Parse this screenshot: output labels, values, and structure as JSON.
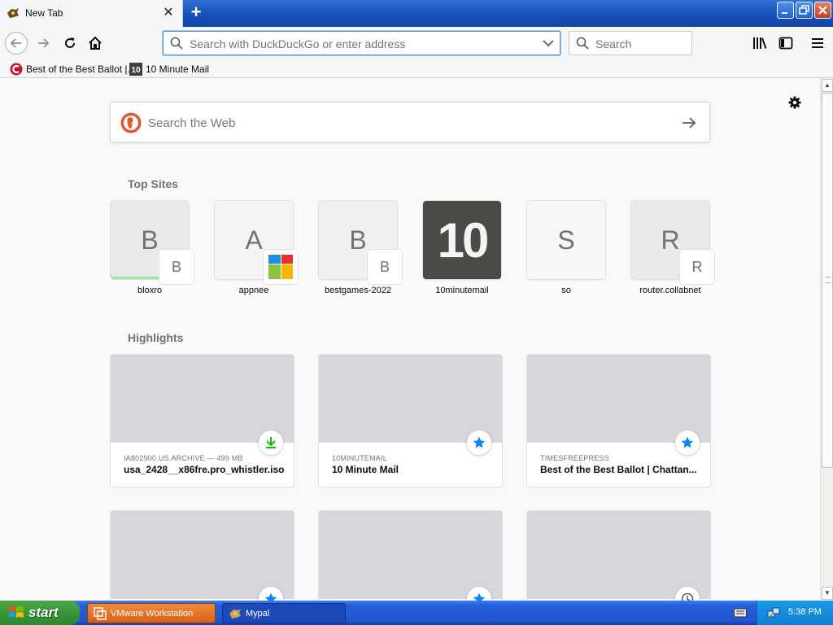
{
  "window": {
    "tab_title": "New Tab",
    "new_tab_symbol": "+",
    "close_symbol": "✕"
  },
  "navbar": {
    "url_placeholder": "Search with DuckDuckGo or enter address",
    "search_placeholder": "Search"
  },
  "bookmarks": [
    {
      "label": "Best of the Best Ballot |...",
      "icon": "cincinnati-c-icon"
    },
    {
      "label": "10 Minute Mail",
      "icon": "ten-icon"
    }
  ],
  "content": {
    "websearch_placeholder": "Search the Web",
    "top_sites_title": "Top Sites",
    "highlights_title": "Highlights",
    "top_sites": [
      {
        "label": "bloxro",
        "letter": "B",
        "badge": "B"
      },
      {
        "label": "appnee",
        "letter": "A",
        "badge": ""
      },
      {
        "label": "bestgames-2022",
        "letter": "B",
        "badge": "B"
      },
      {
        "label": "10minutemail",
        "letter": "10",
        "badge": ""
      },
      {
        "label": "so",
        "letter": "S",
        "badge": ""
      },
      {
        "label": "router.collabnet",
        "letter": "R",
        "badge": "R"
      }
    ],
    "highlights": [
      {
        "source": "IA802900.US.ARCHIVE — 499 MB",
        "title": "usa_2428__x86fre.pro_whistler.iso",
        "badge": "download-icon"
      },
      {
        "source": "10MINUTEMAIL",
        "title": "10 Minute Mail",
        "badge": "star-icon"
      },
      {
        "source": "TIMESFREEPRESS",
        "title": "Best of the Best Ballot | Chattan...",
        "badge": "star-icon"
      },
      {
        "source": "",
        "title": "",
        "badge": "star-icon"
      },
      {
        "source": "",
        "title": "",
        "badge": "star-icon"
      },
      {
        "source": "",
        "title": "",
        "badge": "clock-icon"
      }
    ]
  },
  "taskbar": {
    "start_label": "start",
    "tasks": [
      {
        "label": "VMware Workstation"
      },
      {
        "label": "Mypal"
      }
    ],
    "clock": "5:38 PM"
  },
  "colors": {
    "accent_blue": "#0a84ff",
    "download_green": "#12bc00",
    "xp_taskbar": "#245edb"
  }
}
